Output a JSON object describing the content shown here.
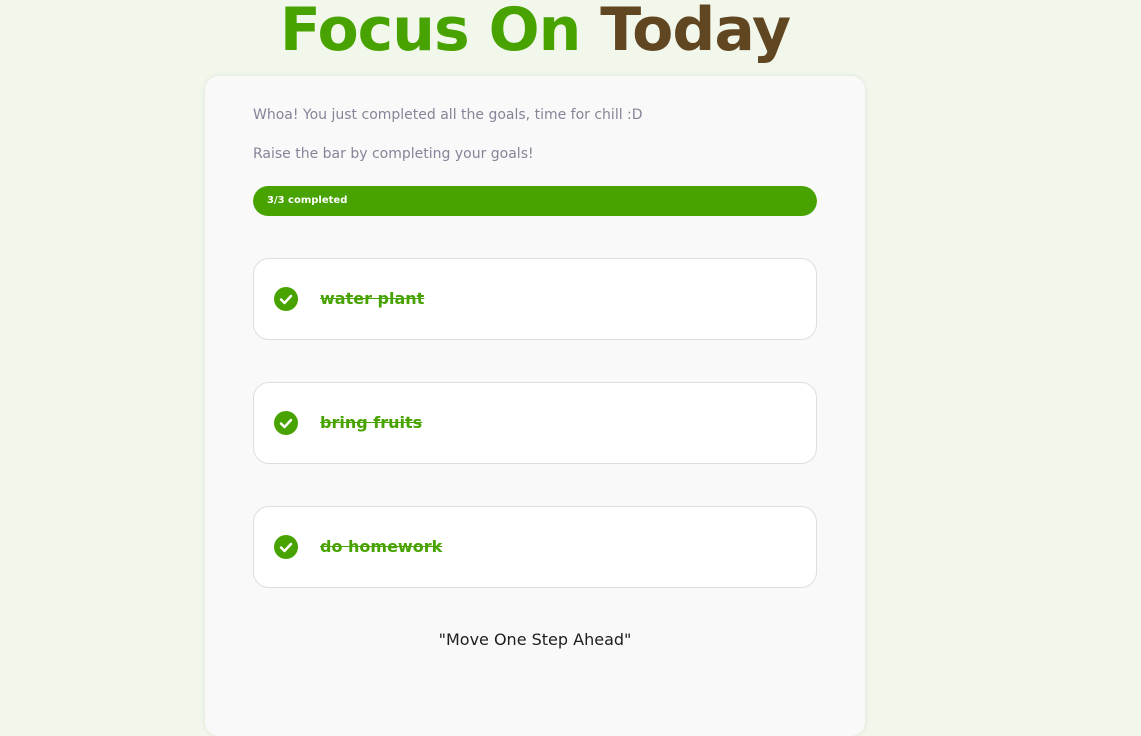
{
  "header": {
    "title_part1": "Focus On",
    "title_part2": "Today"
  },
  "colors": {
    "accent_green": "#48a300",
    "brown": "#614622",
    "page_background": "#f2f7ec",
    "card_background": "#f9f9f9",
    "muted_text": "#858598"
  },
  "card": {
    "completion_message": "Whoa! You just completed all the goals, time for chill :D",
    "subtitle": "Raise the bar by completing your goals!",
    "progress": {
      "label": "3/3 completed",
      "completed": 3,
      "total": 3,
      "fraction": 1.0
    },
    "goals": [
      {
        "text": "water plant",
        "completed": true,
        "icon": "check-circle-icon"
      },
      {
        "text": "bring fruits",
        "completed": true,
        "icon": "check-circle-icon"
      },
      {
        "text": "do homework",
        "completed": true,
        "icon": "check-circle-icon"
      }
    ],
    "quote": "\"Move One Step Ahead\""
  }
}
